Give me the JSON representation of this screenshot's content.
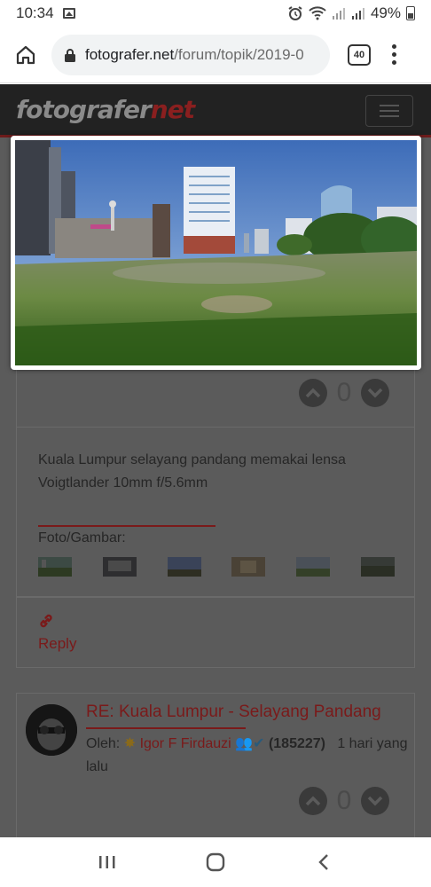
{
  "status_bar": {
    "time": "10:34",
    "battery": "49%"
  },
  "browser": {
    "url_domain": "fotografer.net",
    "url_path": "/forum/topik/2019-0",
    "tab_count": "40"
  },
  "site": {
    "logo_main": "fotografer",
    "logo_accent": "net"
  },
  "post": {
    "vote_count": "0",
    "body": "Kuala Lumpur selayang pandang memakai lensa Voigtlander 10mm f/5.6mm",
    "photos_label": "Foto/Gambar:",
    "reply_label": "Reply"
  },
  "reply_post": {
    "title": "RE: Kuala Lumpur - Selayang Pandang",
    "by_label": "Oleh:",
    "author": "Igor F Firdauzi",
    "points": "(185227)",
    "time": "1 hari yang lalu",
    "vote_count": "0"
  },
  "colors": {
    "accent": "#7a1a1a",
    "overlay_bg": "#5b5b5b"
  },
  "icons": {
    "home": "home-icon",
    "lock": "lock-icon",
    "menu": "more-vert-icon",
    "upvote": "chevron-up-icon",
    "downvote": "chevron-down-icon",
    "link": "link-icon"
  }
}
